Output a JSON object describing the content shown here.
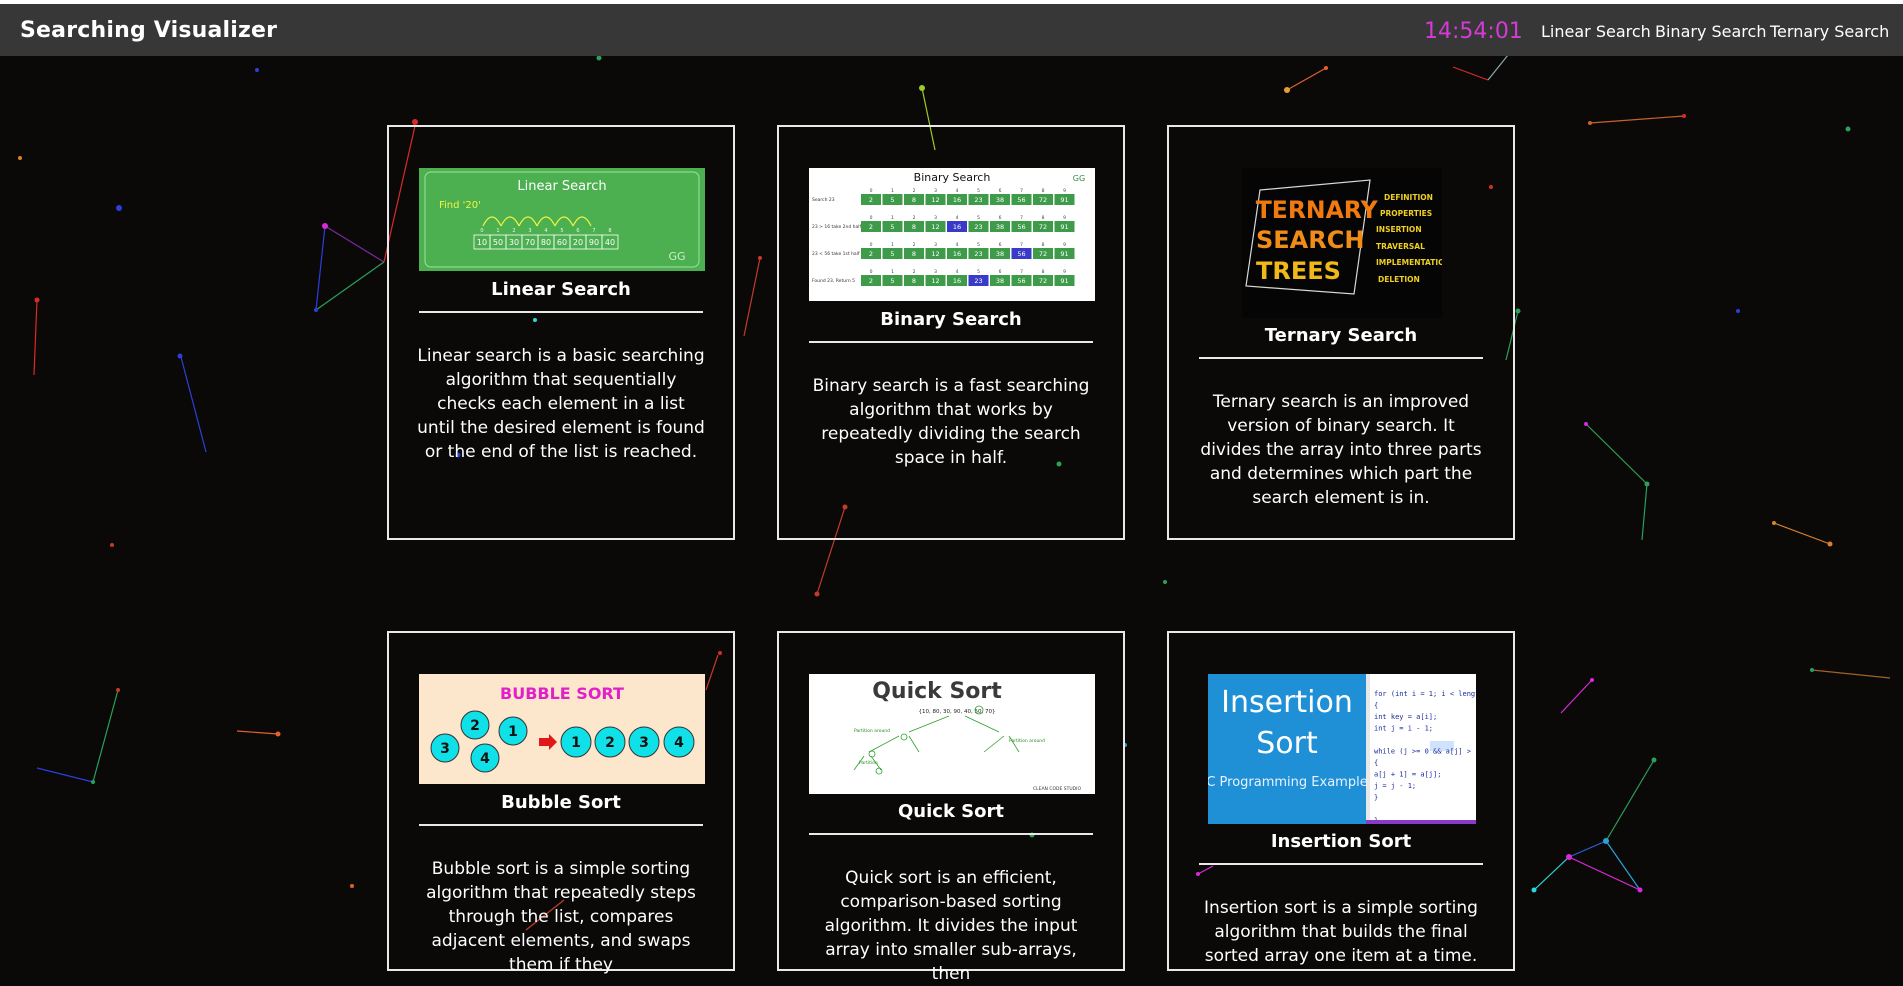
{
  "navbar": {
    "brand": "Searching Visualizer",
    "clock": "14:54:01",
    "links": [
      "Linear Search",
      "Binary Search",
      "Ternary Search"
    ]
  },
  "colors": {
    "page_bg": "#0a0908",
    "navbar_bg": "#373737",
    "clock": "#d63ad6",
    "card_border": "#e8e8e8",
    "linear_green": "#4caf50",
    "bubble_cyan": "#10e0e8",
    "insertion_blue": "#1f8fd6"
  },
  "cards": [
    {
      "title": "Linear Search",
      "description": "Linear search is a basic searching algorithm that sequentially checks each element in a list until the desired element is found or the end of the list is reached.",
      "image": {
        "heading": "Linear Search",
        "find_label": "Find '20'",
        "indices": [
          "0",
          "1",
          "2",
          "3",
          "4",
          "5",
          "6",
          "7",
          "8"
        ],
        "values": [
          "10",
          "50",
          "30",
          "70",
          "80",
          "60",
          "20",
          "90",
          "40"
        ],
        "logo": "GG"
      }
    },
    {
      "title": "Binary Search",
      "description": "Binary search is a fast searching algorithm that works by repeatedly dividing the search space in half.",
      "image": {
        "heading": "Binary Search",
        "values": [
          "2",
          "5",
          "8",
          "12",
          "16",
          "23",
          "38",
          "56",
          "72",
          "91"
        ],
        "row_labels": [
          "Search 23",
          "23 > 16 take 2nd half",
          "23 < 56 take 1st half",
          "Found 23, Return 5"
        ],
        "logo": "GG"
      }
    },
    {
      "title": "Ternary Search",
      "description": "Ternary search is an improved version of binary search. It divides the array into three parts and determines which part the search element is in.",
      "image": {
        "lines": [
          "TERNARY",
          "SEARCH",
          "TREES"
        ],
        "topics": [
          "DEFINITION",
          "PROPERTIES",
          "INSERTION",
          "TRAVERSAL",
          "IMPLEMENTATION",
          "DELETION"
        ]
      }
    },
    {
      "title": "Bubble Sort",
      "description": "Bubble sort is a simple sorting algorithm that repeatedly steps through the list, compares adjacent elements, and swaps them if they",
      "image": {
        "heading": "BUBBLE SORT",
        "unsorted": [
          "2",
          "1",
          "3",
          "4"
        ],
        "sorted": [
          "1",
          "2",
          "3",
          "4"
        ]
      }
    },
    {
      "title": "Quick Sort",
      "description": "Quick sort is an efficient, comparison-based sorting algorithm. It divides the input array into smaller sub-arrays, then",
      "image": {
        "heading": "Quick Sort",
        "root": "{10, 80, 30, 90, 40, 50, 70}",
        "footer": "CLEAN CODE STUDIO"
      }
    },
    {
      "title": "Insertion Sort",
      "description": "Insertion sort is a simple sorting algorithm that builds the final sorted array one item at a time.",
      "image": {
        "line1": "Insertion",
        "line2": "Sort",
        "subtitle": "C Programming Example",
        "code": [
          "for (int i = 1; i < lengt",
          "{",
          "  int key = a[i];",
          "  int j = i - 1;",
          "",
          "  while (j >= 0 && a[j] >",
          "  {",
          "    a[j + 1] = a[j];",
          "    j = j - 1;",
          "  }",
          "",
          "}"
        ]
      }
    }
  ]
}
